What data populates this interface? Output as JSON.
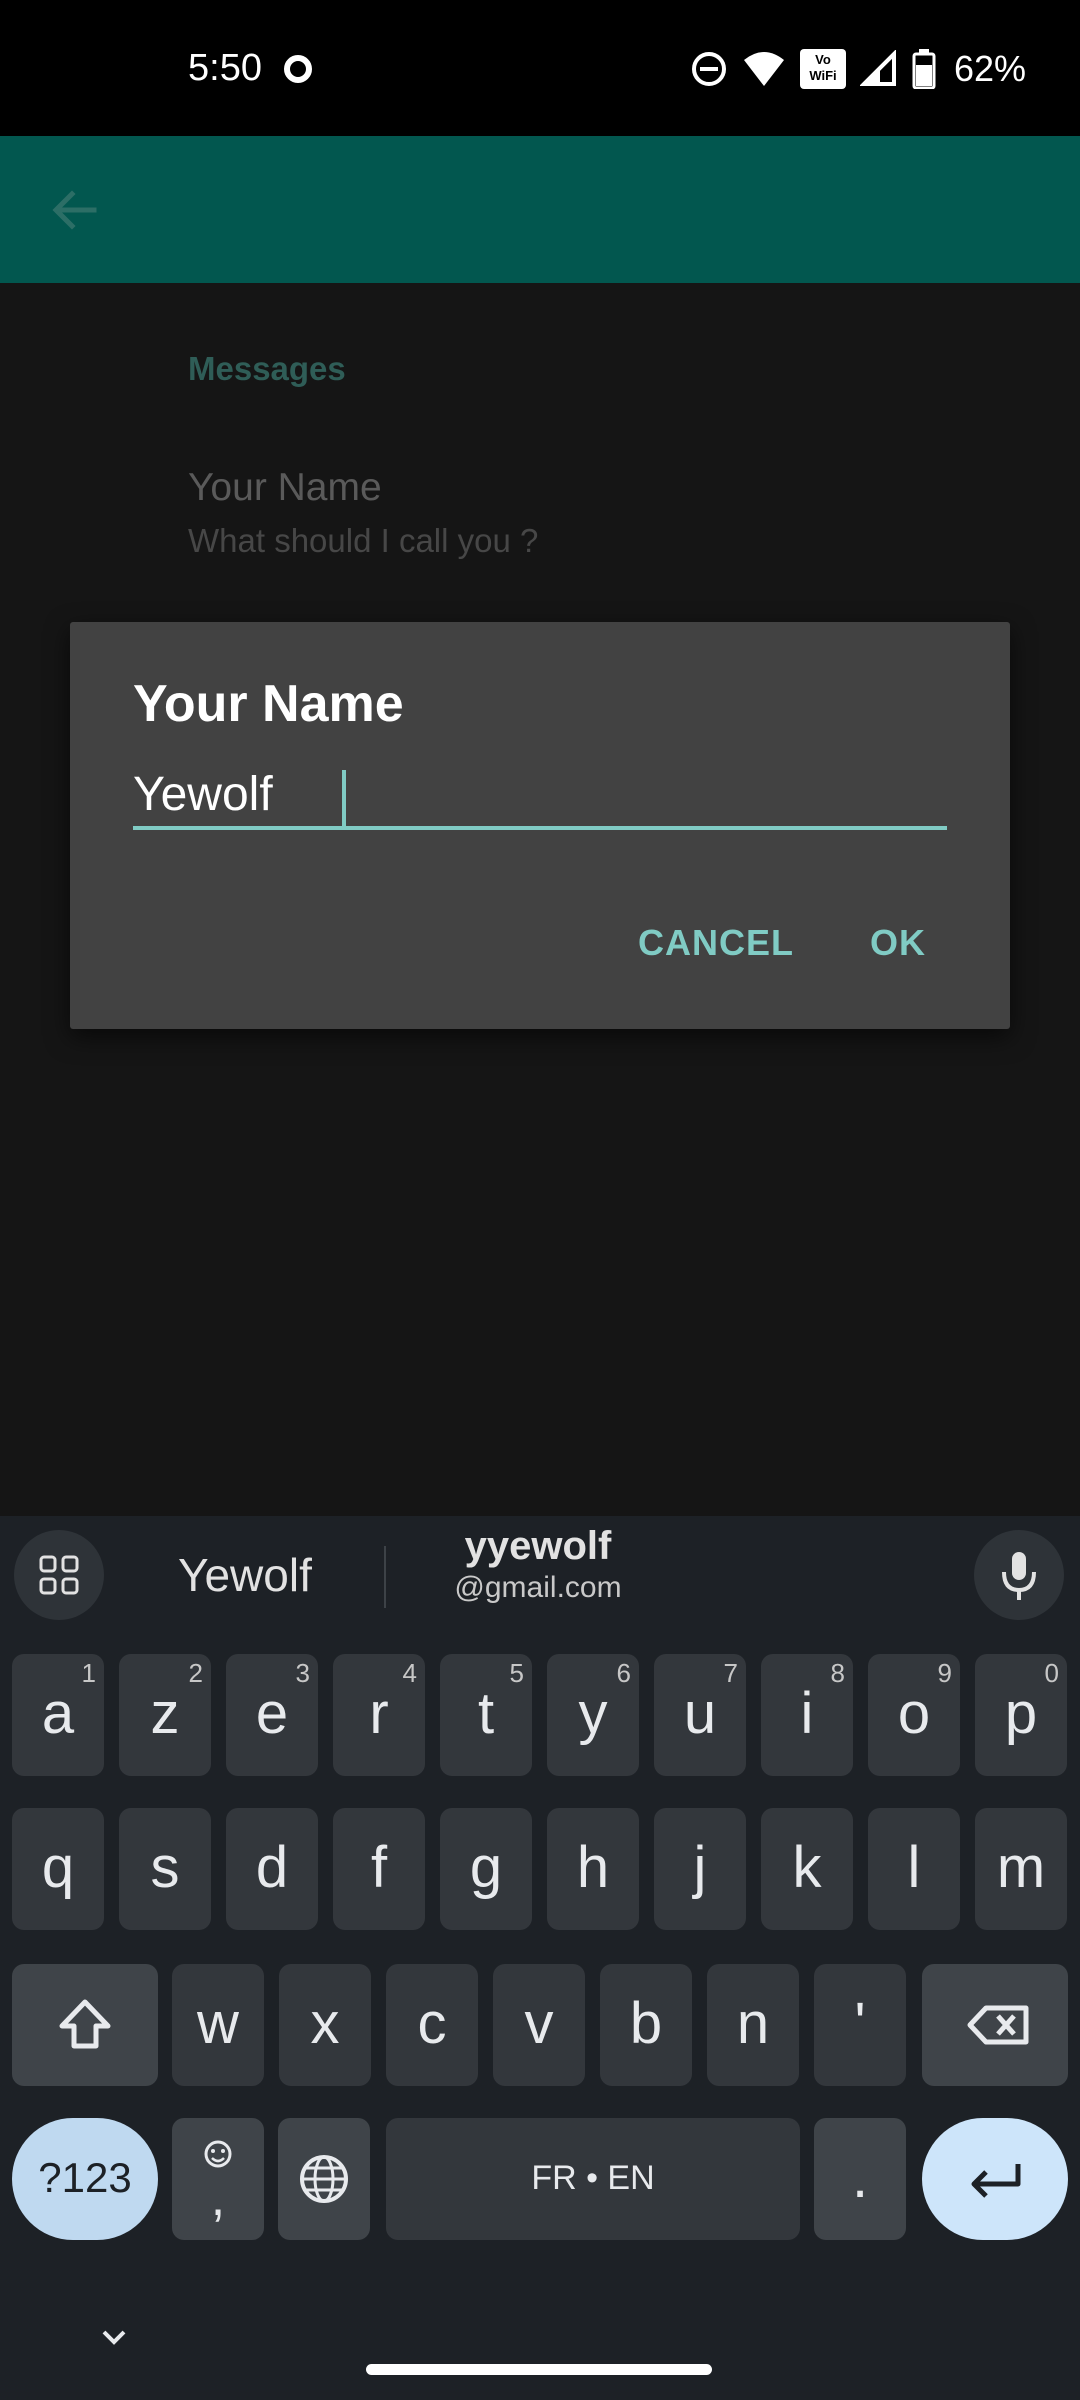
{
  "status_bar": {
    "time": "5:50",
    "battery": "62%",
    "vowifi_top": "Vo",
    "vowifi_bottom": "WiFi"
  },
  "app_bar": {
    "back_icon": "arrow-back-icon",
    "color": "#02574F"
  },
  "settings": {
    "category": "Messages",
    "pref_title": "Your Name",
    "pref_summary": "What should I call you ?"
  },
  "dialog": {
    "title": "Your Name",
    "input_value": "Yewolf",
    "cancel_label": "CANCEL",
    "ok_label": "OK",
    "accent": "#80CBC4"
  },
  "keyboard": {
    "suggestions": {
      "first": "Yewolf",
      "second_main": "yyewolf",
      "second_sub": "@gmail.com"
    },
    "row1": [
      {
        "ch": "a",
        "hint": "1"
      },
      {
        "ch": "z",
        "hint": "2"
      },
      {
        "ch": "e",
        "hint": "3"
      },
      {
        "ch": "r",
        "hint": "4"
      },
      {
        "ch": "t",
        "hint": "5"
      },
      {
        "ch": "y",
        "hint": "6"
      },
      {
        "ch": "u",
        "hint": "7"
      },
      {
        "ch": "i",
        "hint": "8"
      },
      {
        "ch": "o",
        "hint": "9"
      },
      {
        "ch": "p",
        "hint": "0"
      }
    ],
    "row2": [
      "q",
      "s",
      "d",
      "f",
      "g",
      "h",
      "j",
      "k",
      "l",
      "m"
    ],
    "row3": [
      "w",
      "x",
      "c",
      "v",
      "b",
      "n",
      "'"
    ],
    "symbols_label": "?123",
    "emoji_comma": ",",
    "space_label": "FR • EN",
    "period_label": "."
  }
}
